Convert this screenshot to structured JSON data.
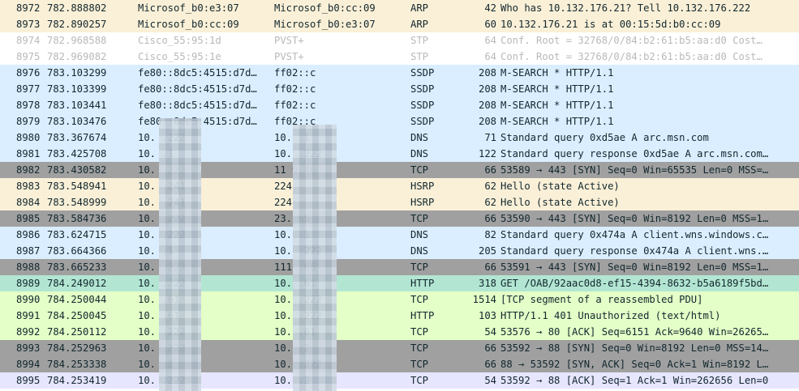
{
  "colors": {
    "arp": "#faf0d7",
    "stp": "#ffffff",
    "ssdp_dns": "#daeeff",
    "tcp_syn": "#a0a0a0",
    "hsrp": "#faf0d7",
    "http": "#b3e6d2",
    "tcp_http": "#e4ffc7",
    "tcp_ack_last": "#e7e6ff",
    "redaction": "#b9c8d6"
  },
  "packets": [
    {
      "no": "8972",
      "time": "782.888802",
      "src": "Microsof_b0:e3:07",
      "dst": "Microsof_b0:cc:09",
      "proto": "ARP",
      "len": "42",
      "info": "Who has 10.132.176.21? Tell 10.132.176.222",
      "bg": "#faf0d7",
      "dim": false
    },
    {
      "no": "8973",
      "time": "782.890257",
      "src": "Microsof_b0:cc:09",
      "dst": "Microsof_b0:e3:07",
      "proto": "ARP",
      "len": "60",
      "info": "10.132.176.21 is at 00:15:5d:b0:cc:09",
      "bg": "#faf0d7",
      "dim": false
    },
    {
      "no": "8974",
      "time": "782.968588",
      "src": "Cisco_55:95:1d",
      "dst": "PVST+",
      "proto": "STP",
      "len": "64",
      "info": "Conf. Root = 32768/0/84:b2:61:b5:aa:d0  Cost…",
      "bg": "#ffffff",
      "dim": true
    },
    {
      "no": "8975",
      "time": "782.969082",
      "src": "Cisco_55:95:1e",
      "dst": "PVST+",
      "proto": "STP",
      "len": "64",
      "info": "Conf. Root = 32768/0/84:b2:61:b5:aa:d0  Cost…",
      "bg": "#ffffff",
      "dim": true
    },
    {
      "no": "8976",
      "time": "783.103299",
      "src": "fe80::8dc5:4515:d7d…",
      "dst": "ff02::c",
      "proto": "SSDP",
      "len": "208",
      "info": "M-SEARCH * HTTP/1.1",
      "bg": "#daeeff",
      "dim": false
    },
    {
      "no": "8977",
      "time": "783.103399",
      "src": "fe80::8dc5:4515:d7d…",
      "dst": "ff02::c",
      "proto": "SSDP",
      "len": "208",
      "info": "M-SEARCH * HTTP/1.1",
      "bg": "#daeeff",
      "dim": false
    },
    {
      "no": "8978",
      "time": "783.103441",
      "src": "fe80::8dc5:4515:d7d…",
      "dst": "ff02::c",
      "proto": "SSDP",
      "len": "208",
      "info": "M-SEARCH * HTTP/1.1",
      "bg": "#daeeff",
      "dim": false
    },
    {
      "no": "8979",
      "time": "783.103476",
      "src": "fe80::8dc5:4515:d7d…",
      "dst": "ff02::c",
      "proto": "SSDP",
      "len": "208",
      "info": "M-SEARCH * HTTP/1.1",
      "bg": "#daeeff",
      "dim": false
    },
    {
      "no": "8980",
      "time": "783.367674",
      "src": "10.        .222",
      "dst": "10.        .1",
      "proto": "DNS",
      "len": "71",
      "info": "Standard query 0xd5ae A arc.msn.com",
      "bg": "#daeeff",
      "dim": false
    },
    {
      "no": "8981",
      "time": "783.425708",
      "src": "10.        .1",
      "dst": "10.        .222",
      "proto": "DNS",
      "len": "122",
      "info": "Standard query response 0xd5ae A arc.msn.com…",
      "bg": "#daeeff",
      "dim": false
    },
    {
      "no": "8982",
      "time": "783.430582",
      "src": "10.        .222",
      "dst": "11      9.46",
      "proto": "TCP",
      "len": "66",
      "info": "53589 → 443 [SYN] Seq=0 Win=65535 Len=0 MSS=…",
      "bg": "#a0a0a0",
      "dim": false
    },
    {
      "no": "8983",
      "time": "783.548941",
      "src": "10.        .241",
      "dst": "224",
      "proto": "HSRP",
      "len": "62",
      "info": "Hello (state Active)",
      "bg": "#faf0d7",
      "dim": false
    },
    {
      "no": "8984",
      "time": "783.548999",
      "src": "10.        .241",
      "dst": "224",
      "proto": "HSRP",
      "len": "62",
      "info": "Hello (state Active)",
      "bg": "#faf0d7",
      "dim": false
    },
    {
      "no": "8985",
      "time": "783.584736",
      "src": "10.        .222",
      "dst": "23.       65",
      "proto": "TCP",
      "len": "66",
      "info": "53590 → 443 [SYN] Seq=0 Win=8192 Len=0 MSS=1…",
      "bg": "#a0a0a0",
      "dim": false
    },
    {
      "no": "8986",
      "time": "783.624715",
      "src": "10.        .222",
      "dst": "10.        .1",
      "proto": "DNS",
      "len": "82",
      "info": "Standard query 0x474a A client.wns.windows.c…",
      "bg": "#daeeff",
      "dim": false
    },
    {
      "no": "8987",
      "time": "783.664366",
      "src": "10.        .1",
      "dst": "10.        .222",
      "proto": "DNS",
      "len": "205",
      "info": "Standard query response 0x474a A client.wns.…",
      "bg": "#daeeff",
      "dim": false
    },
    {
      "no": "8988",
      "time": "783.665233",
      "src": "10.        .222",
      "dst": "111       .66",
      "proto": "TCP",
      "len": "66",
      "info": "53591 → 443 [SYN] Seq=0 Win=8192 Len=0 MSS=1…",
      "bg": "#a0a0a0",
      "dim": false
    },
    {
      "no": "8989",
      "time": "784.249012",
      "src": "10.        .222",
      "dst": "10.        .61",
      "proto": "HTTP",
      "len": "318",
      "info": "GET /OAB/92aac0d8-ef15-4394-8632-b5a6189f5bd…",
      "bg": "#b3e6d2",
      "dim": false
    },
    {
      "no": "8990",
      "time": "784.250044",
      "src": "10.        .61",
      "dst": "10.        .222",
      "proto": "TCP",
      "len": "1514",
      "info": "[TCP segment of a reassembled PDU]",
      "bg": "#e4ffc7",
      "dim": false
    },
    {
      "no": "8991",
      "time": "784.250045",
      "src": "10.        .61",
      "dst": "10.        .222",
      "proto": "HTTP",
      "len": "103",
      "info": "HTTP/1.1 401 Unauthorized  (text/html)",
      "bg": "#e4ffc7",
      "dim": false
    },
    {
      "no": "8992",
      "time": "784.250112",
      "src": "10.        .222",
      "dst": "10.        .61",
      "proto": "TCP",
      "len": "54",
      "info": "53576 → 80 [ACK] Seq=6151 Ack=9640 Win=26265…",
      "bg": "#e4ffc7",
      "dim": false
    },
    {
      "no": "8993",
      "time": "784.252963",
      "src": "10.        .222",
      "dst": "10.        .2",
      "proto": "TCP",
      "len": "66",
      "info": "53592 → 88 [SYN] Seq=0 Win=8192 Len=0 MSS=14…",
      "bg": "#a0a0a0",
      "dim": false
    },
    {
      "no": "8994",
      "time": "784.253338",
      "src": "10.        .2",
      "dst": "10.        .222",
      "proto": "TCP",
      "len": "66",
      "info": "88 → 53592 [SYN, ACK] Seq=0 Ack=1 Win=8192 L…",
      "bg": "#a0a0a0",
      "dim": false
    },
    {
      "no": "8995",
      "time": "784.253419",
      "src": "10.        .222",
      "dst": "10.        .2",
      "proto": "TCP",
      "len": "54",
      "info": "53592 → 88 [ACK] Seq=1 Ack=1 Win=262656 Len=0",
      "bg": "#e7e6ff",
      "dim": false
    }
  ]
}
